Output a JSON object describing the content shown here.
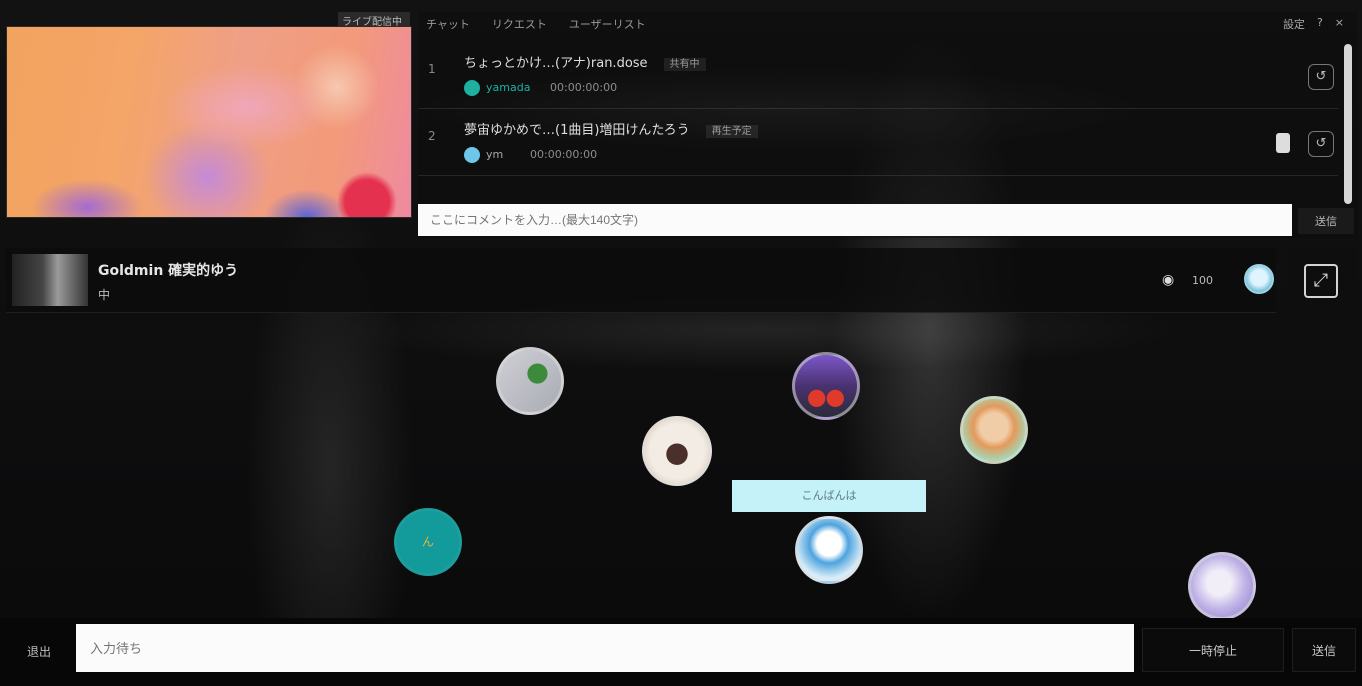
{
  "video": {
    "corner_label": "ライブ配信中"
  },
  "chat": {
    "tabs": [
      "チャット",
      "リクエスト",
      "ユーザーリスト"
    ],
    "tools": [
      "設定",
      "?",
      "×"
    ],
    "messages": [
      {
        "number": "1",
        "text": "ちょっとかけ…(アナ)ran.dose",
        "tag": "共有中",
        "user": "yamada",
        "time": "00:00:00:00"
      },
      {
        "number": "2",
        "text": "夢宙ゆかめで…(1曲目)増田けんたろう",
        "tag": "再生予定",
        "user": "ym",
        "time": "00:00:00:00"
      }
    ],
    "input_placeholder": "ここにコメントを入力…(最大140文字)",
    "send_label": "送信"
  },
  "player": {
    "title": "Goldmin 確実的ゆう",
    "subtitle": "中",
    "volume_label": "100"
  },
  "room": {
    "avatar_5_label": "ん",
    "bubble_text": "こんばんは"
  },
  "bottom": {
    "leave_label": "退出",
    "message_placeholder": "入力待ち",
    "random_label": "一時停止",
    "submit_label": "送信"
  },
  "colors": {
    "accent_teal": "#139a9a",
    "bubble_cyan": "#c5f1f8",
    "input_bg": "#fbfbfb"
  }
}
